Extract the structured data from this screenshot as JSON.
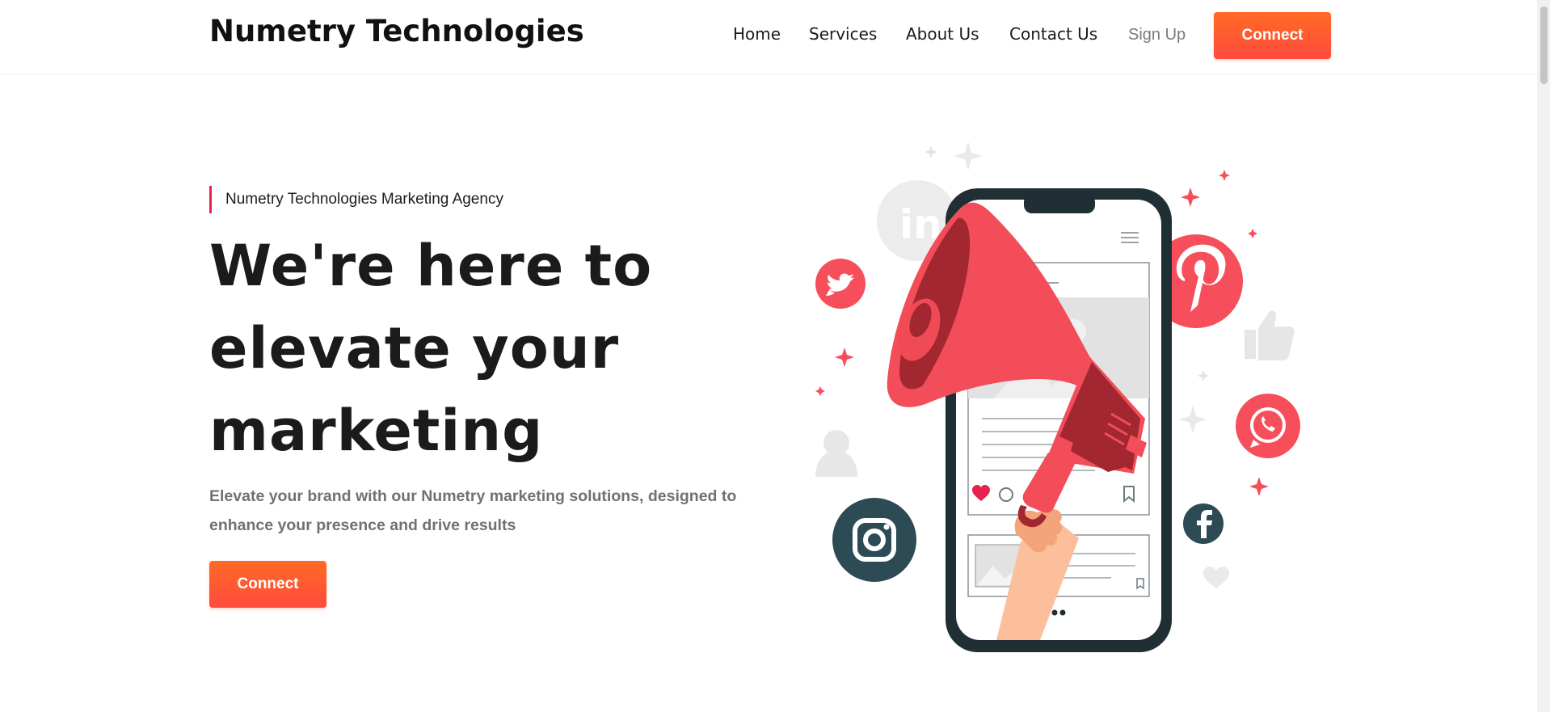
{
  "header": {
    "brand": "Numetry Technologies",
    "nav": [
      {
        "label": "Home"
      },
      {
        "label": "Services"
      },
      {
        "label": "About Us"
      },
      {
        "label": "Contact Us"
      },
      {
        "label": "Sign Up"
      }
    ],
    "cta_label": "Connect"
  },
  "hero": {
    "eyebrow": "Numetry Technologies Marketing Agency",
    "title_lines": [
      "We're here to",
      "elevate your",
      "marketing"
    ],
    "description": "Elevate your brand with our Numetry marketing solutions, designed to enhance your presence and drive results",
    "cta_label": "Connect"
  },
  "illustration": {
    "social_icons": [
      "linkedin-icon",
      "twitter-icon",
      "pinterest-icon",
      "whatsapp-icon",
      "instagram-icon",
      "facebook-icon",
      "thumbs-up-icon",
      "user-icon",
      "heart-icon"
    ],
    "colors": {
      "accent": "#f64f5b",
      "dark": "#2d4b55",
      "phone": "#1f2f33",
      "megaphone": "#f24d58",
      "megaphone_dark": "#a22731",
      "grey": "#e7e7e7",
      "button": "#ff5a30"
    }
  }
}
